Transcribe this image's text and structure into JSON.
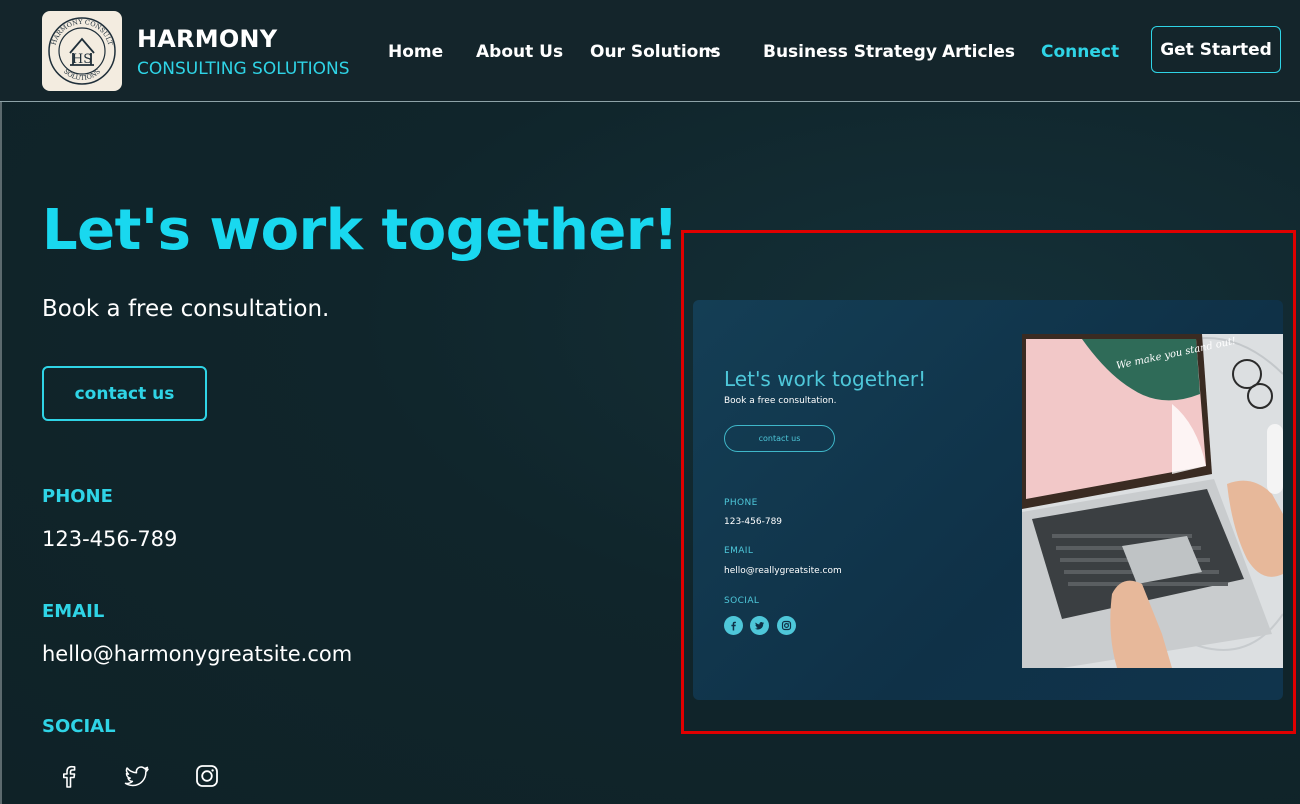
{
  "brand": {
    "title": "HARMONY",
    "subtitle": "CONSULTING SOLUTIONS",
    "logo_text_top": "HARMONY CONSULT",
    "logo_text_bottom": "SOLUTIONS",
    "logo_monogram": "HS"
  },
  "nav": {
    "items": [
      {
        "label": "Home"
      },
      {
        "label": "About Us"
      },
      {
        "label": "Our Solutions"
      },
      {
        "label": "Business Strategy"
      },
      {
        "label": "Articles"
      },
      {
        "label": "Connect"
      }
    ],
    "active": "Connect",
    "cta_label": "Get Started"
  },
  "hero": {
    "title": "Let's work together!",
    "subtitle": "Book a free consultation.",
    "button_label": "contact us"
  },
  "contact": {
    "phone_label": "PHONE",
    "phone": "123-456-789",
    "email_label": "EMAIL",
    "email": "hello@harmonygreatsite.com",
    "social_label": "SOCIAL",
    "social_icons": [
      "facebook-icon",
      "twitter-icon",
      "instagram-icon"
    ]
  },
  "preview": {
    "title": "Let's work together!",
    "subtitle": "Book a free consultation.",
    "button_label": "contact us",
    "phone_label": "PHONE",
    "phone": "123-456-789",
    "email_label": "EMAIL",
    "email": "hello@reallygreatsite.com",
    "social_label": "SOCIAL",
    "screen_text": "We make you stand out!"
  },
  "colors": {
    "accent": "#2fd4e6",
    "hero_title": "#19d8ef",
    "highlight": "#e00000",
    "background": "#10252b"
  }
}
